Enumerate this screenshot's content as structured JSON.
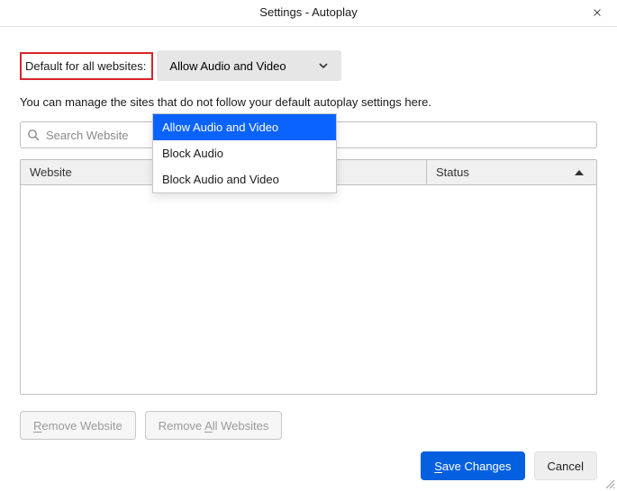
{
  "window": {
    "title": "Settings - Autoplay"
  },
  "default_row": {
    "label": "Default for all websites:",
    "selected": "Allow Audio and Video",
    "options": [
      "Allow Audio and Video",
      "Block Audio",
      "Block Audio and Video"
    ]
  },
  "help_text": "You can manage the sites that do not follow your default autoplay settings here.",
  "search": {
    "placeholder": "Search Website"
  },
  "table": {
    "columns": {
      "website": "Website",
      "status": "Status"
    },
    "rows": []
  },
  "actions": {
    "remove": "Remove Website",
    "remove_all": "Remove All Websites"
  },
  "footer": {
    "save": "Save Changes",
    "cancel": "Cancel"
  }
}
